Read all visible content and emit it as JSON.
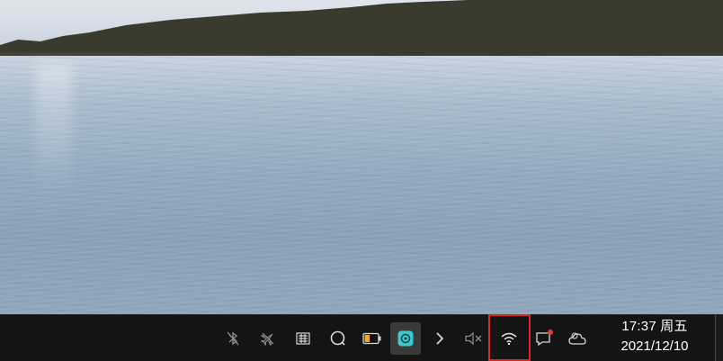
{
  "taskbar": {
    "tray_icons": [
      {
        "name": "bluetooth-off-icon"
      },
      {
        "name": "airplane-mode-icon"
      },
      {
        "name": "input-method-icon"
      },
      {
        "name": "search-icon"
      },
      {
        "name": "battery-icon",
        "level": 0.4,
        "color": "#f2a530"
      },
      {
        "name": "app-indicator-icon",
        "color": "#3ccad0",
        "active": true
      },
      {
        "name": "chevron-right-icon"
      },
      {
        "name": "volume-muted-icon"
      },
      {
        "name": "wifi-icon",
        "highlighted": true,
        "highlight_color": "#e0271f"
      },
      {
        "name": "notification-icon",
        "badge_color": "#e53935"
      },
      {
        "name": "weather-cloud-icon"
      }
    ],
    "clock": {
      "time": "17:37 周五",
      "date": "2021/12/10"
    }
  },
  "colors": {
    "taskbar_bg": "#141414",
    "icon_color": "#d8d8d8"
  }
}
